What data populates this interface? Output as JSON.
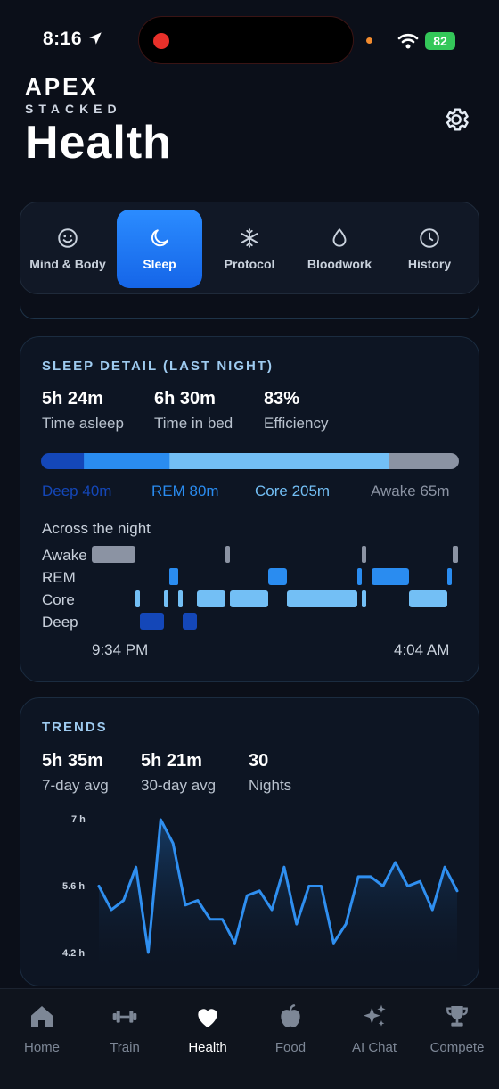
{
  "status_bar": {
    "time": "8:16",
    "battery": "82"
  },
  "header": {
    "brand": "APEX",
    "brand_sub": "STACKED",
    "title": "Health"
  },
  "tabs": [
    {
      "label": "Mind & Body",
      "icon": "smile-icon",
      "active": false
    },
    {
      "label": "Sleep",
      "icon": "moon-icon",
      "active": true
    },
    {
      "label": "Protocol",
      "icon": "snowflake-icon",
      "active": false
    },
    {
      "label": "Bloodwork",
      "icon": "drop-icon",
      "active": false
    },
    {
      "label": "History",
      "icon": "clock-icon",
      "active": false
    }
  ],
  "sleep_detail": {
    "title": "SLEEP DETAIL (LAST NIGHT)",
    "stats": [
      {
        "value": "5h 24m",
        "label": "Time asleep"
      },
      {
        "value": "6h 30m",
        "label": "Time in bed"
      },
      {
        "value": "83%",
        "label": "Efficiency"
      }
    ],
    "segments": [
      {
        "name": "Deep",
        "text": "Deep 40m",
        "minutes": 40,
        "color": "#1447b8"
      },
      {
        "name": "REM",
        "text": "REM 80m",
        "minutes": 80,
        "color": "#2a8cf0"
      },
      {
        "name": "Core",
        "text": "Core 205m",
        "minutes": 205,
        "color": "#73bff5"
      },
      {
        "name": "Awake",
        "text": "Awake 65m",
        "minutes": 65,
        "color": "#8b93a3"
      }
    ],
    "timeline_title": "Across the night",
    "rows": [
      "Awake",
      "REM",
      "Core",
      "Deep"
    ],
    "start_time": "9:34 PM",
    "end_time": "4:04 AM"
  },
  "trends": {
    "title": "TRENDS",
    "stats": [
      {
        "value": "5h 35m",
        "label": "7-day avg"
      },
      {
        "value": "5h 21m",
        "label": "30-day avg"
      },
      {
        "value": "30",
        "label": "Nights"
      }
    ]
  },
  "chart_data": {
    "type": "area",
    "title": "",
    "xlabel": "",
    "ylabel": "",
    "yticks": [
      "7 h",
      "5.6 h",
      "4.2 h"
    ],
    "ylim": [
      4.2,
      7.0
    ],
    "line_color": "#2f8ff0",
    "values": [
      5.6,
      5.1,
      5.3,
      6.0,
      4.2,
      7.0,
      6.5,
      5.2,
      5.3,
      4.9,
      4.9,
      4.4,
      5.4,
      5.5,
      5.1,
      6.0,
      4.8,
      5.6,
      5.6,
      4.4,
      4.8,
      5.8,
      5.8,
      5.6,
      6.1,
      5.6,
      5.7,
      5.1,
      6.0,
      5.5
    ]
  },
  "bottom_nav": [
    {
      "label": "Home",
      "icon": "home-icon",
      "active": false
    },
    {
      "label": "Train",
      "icon": "dumbbell-icon",
      "active": false
    },
    {
      "label": "Health",
      "icon": "heart-icon",
      "active": true
    },
    {
      "label": "Food",
      "icon": "apple-icon",
      "active": false
    },
    {
      "label": "AI Chat",
      "icon": "sparkles-icon",
      "active": false
    },
    {
      "label": "Compete",
      "icon": "trophy-icon",
      "active": false
    }
  ]
}
